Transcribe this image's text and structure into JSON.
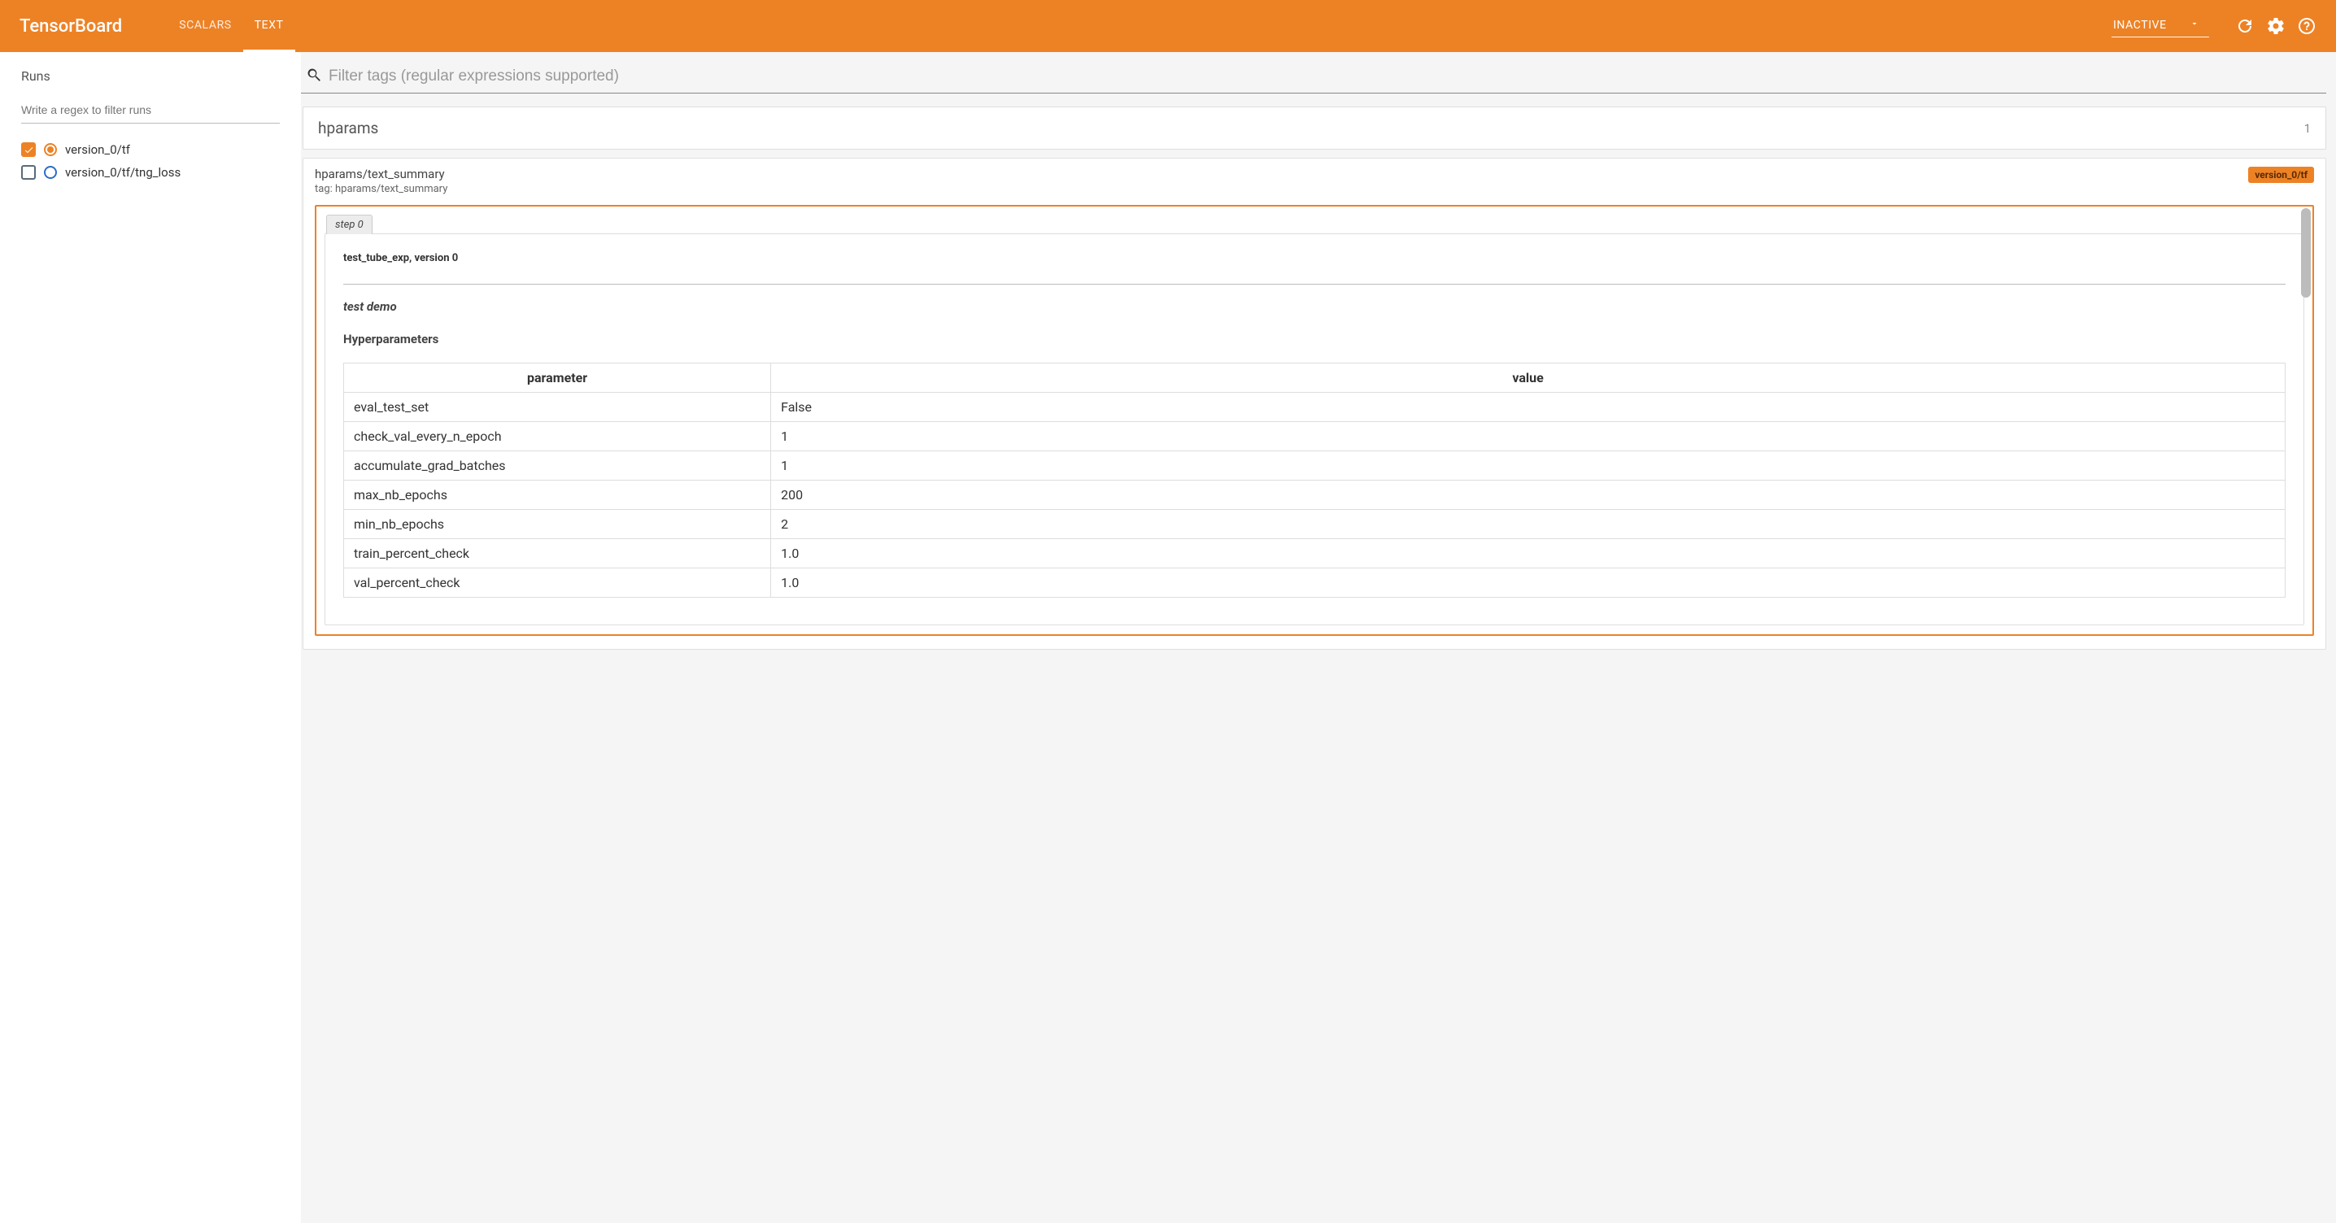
{
  "header": {
    "brand": "TensorBoard",
    "tabs": [
      {
        "label": "SCALARS",
        "active": false
      },
      {
        "label": "TEXT",
        "active": true
      }
    ],
    "select_label": "INACTIVE"
  },
  "sidebar": {
    "title": "Runs",
    "filter_placeholder": "Write a regex to filter runs",
    "runs": [
      {
        "label": "version_0/tf",
        "checked": true,
        "radio": "orange"
      },
      {
        "label": "version_0/tf/tng_loss",
        "checked": false,
        "radio": "blue"
      }
    ]
  },
  "main": {
    "filter_placeholder": "Filter tags (regular expressions supported)",
    "group": {
      "name": "hparams",
      "count": "1"
    },
    "card": {
      "title": "hparams/text_summary",
      "subtitle": "tag: hparams/text_summary",
      "badge": "version_0/tf",
      "step_label": "step 0",
      "run_label": "test_tube_exp, version 0",
      "demo_title": "test demo",
      "hp_heading": "Hyperparameters",
      "columns": {
        "param": "parameter",
        "value": "value"
      },
      "rows": [
        {
          "param": "eval_test_set",
          "value": "False"
        },
        {
          "param": "check_val_every_n_epoch",
          "value": "1"
        },
        {
          "param": "accumulate_grad_batches",
          "value": "1"
        },
        {
          "param": "max_nb_epochs",
          "value": "200"
        },
        {
          "param": "min_nb_epochs",
          "value": "2"
        },
        {
          "param": "train_percent_check",
          "value": "1.0"
        },
        {
          "param": "val_percent_check",
          "value": "1.0"
        }
      ]
    }
  }
}
